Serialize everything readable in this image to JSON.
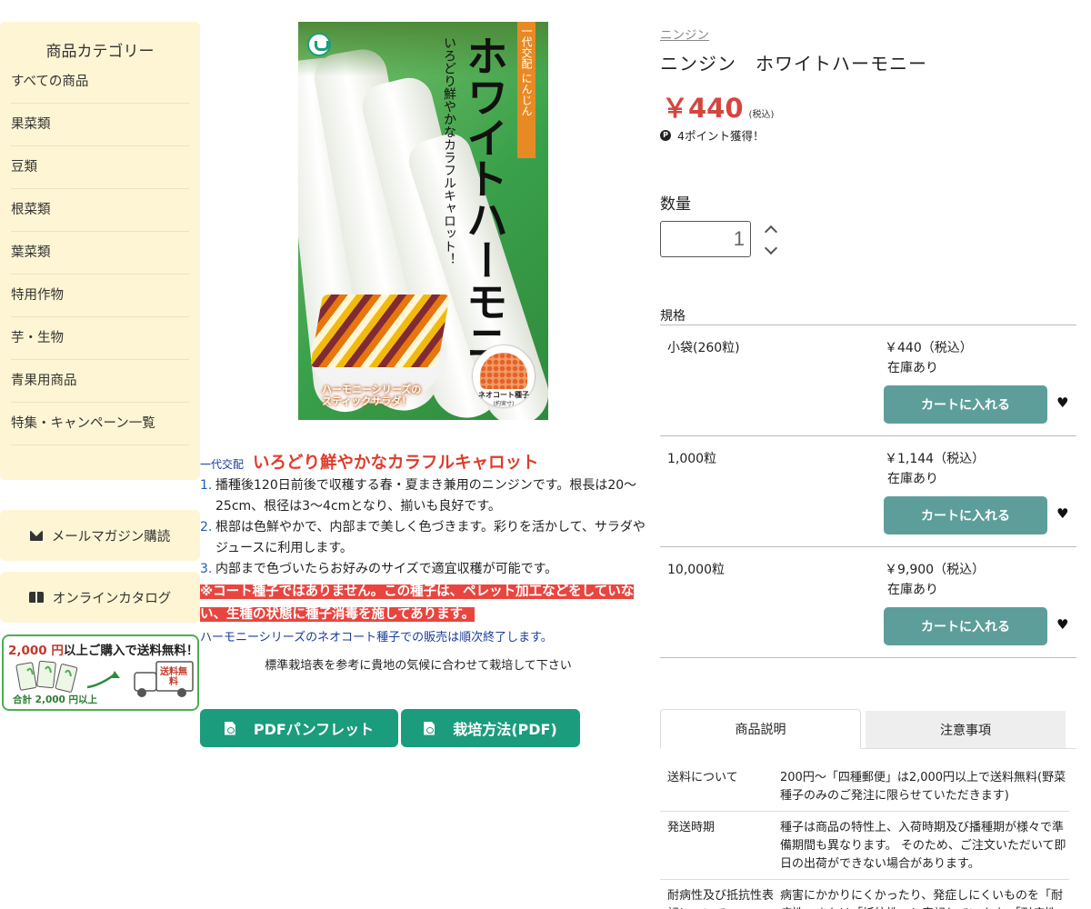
{
  "sidebar": {
    "title": "商品カテゴリー",
    "categories": [
      {
        "label": "すべての商品"
      },
      {
        "label": "果菜類"
      },
      {
        "label": "豆類"
      },
      {
        "label": "根菜類"
      },
      {
        "label": "葉菜類"
      },
      {
        "label": "特用作物"
      },
      {
        "label": "芋・生物"
      },
      {
        "label": "青果用商品"
      },
      {
        "label": "特集・キャンペーン一覧"
      }
    ],
    "newsletter_label": "メールマガジン購読",
    "catalog_label": "オンラインカタログ",
    "shipping_banner": {
      "amount": "2,000 円",
      "text": "以上ご購入で送料無料！",
      "truck_label": "送料無料",
      "total_label": "合計 2,000 円以上"
    }
  },
  "product_image": {
    "series_strip": "一代交配 にんじん",
    "title_vertical": "ホワイトハーモニー",
    "subtitle_vertical": "いろどり鮮やかなカラフルキャロット！",
    "caption": "ハーモニーシリーズの\nスティックサラダ！",
    "seed_label": "ネオコート種子",
    "seed_sub": "(約実寸)"
  },
  "description": {
    "hybrid_label": "一代交配",
    "headline": "いろどり鮮やかなカラフルキャロット",
    "points": [
      {
        "num": "1.",
        "text": "播種後120日前後で収穫する春・夏まき兼用のニンジンです。根長は20〜25cm、根径は3〜4cmとなり、揃いも良好です。"
      },
      {
        "num": "2.",
        "text": "根部は色鮮やかで、内部まで美しく色づきます。彩りを活かして、サラダやジュースに利用します。"
      },
      {
        "num": "3.",
        "text": "内部まで色づいたらお好みのサイズで適宜収穫が可能です。"
      }
    ],
    "warning": "※コート種子ではありません。この種子は、ペレット加工などをしていない、生種の状態に種子消毒を施してあります。",
    "notice": "ハーモニーシリーズのネオコート種子での販売は順次終了します。",
    "cultivation_note": "標準栽培表を参考に貴地の気候に合わせて栽培して下さい"
  },
  "buttons": {
    "pdf_pamphlet": "PDFパンフレット",
    "cultivation_pdf": "栽培方法(PDF)"
  },
  "product": {
    "breadcrumb": "ニンジン",
    "name": "ニンジン　ホワイトハーモニー",
    "price": "￥440",
    "tax_note": "(税込)",
    "points": "4ポイント獲得！",
    "points_icon": "P",
    "quantity_label": "数量",
    "quantity_value": "1",
    "spec_label": "規格"
  },
  "variants": [
    {
      "name": "小袋(260粒)",
      "price": "￥440（税込）",
      "stock": "在庫あり",
      "cart_label": "カートに入れる"
    },
    {
      "name": "1,000粒",
      "price": "￥1,144（税込）",
      "stock": "在庫あり",
      "cart_label": "カートに入れる"
    },
    {
      "name": "10,000粒",
      "price": "￥9,900（税込）",
      "stock": "在庫あり",
      "cart_label": "カートに入れる"
    }
  ],
  "tabs": [
    {
      "label": "商品説明",
      "active": true
    },
    {
      "label": "注意事項",
      "active": false
    }
  ],
  "info": [
    {
      "key": "送料について",
      "value": "200円〜「四種郵便」は2,000円以上で送料無料(野菜種子のみのご発注に限らせていただきます)"
    },
    {
      "key": "発送時期",
      "value": "種子は商品の特性上、入荷時期及び播種期が様々で準備期間も異なります。 そのため、ご注文いただいて即日の出荷ができない場合があります。"
    },
    {
      "key": "耐病性及び抵抗性表記について",
      "value": "病害にかかりにくかったり、発症しにくいものを「耐病性」または「抵抗性」と表記しています。「耐病性」"
    }
  ],
  "colors": {
    "sidebar_bg": "#fdf5d3",
    "accent_green": "#1b9c7d",
    "cart_button": "#5e9e9a",
    "price_red": "#d6453d",
    "warning_bg": "#e9453f"
  }
}
